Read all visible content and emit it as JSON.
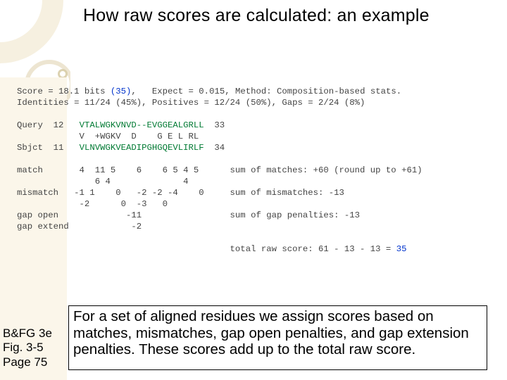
{
  "title": "How raw scores are calculated: an example",
  "blast": {
    "score_line": "Score = 18.1 bits ",
    "score_paren_open": "(",
    "score_value": "35",
    "score_paren_close": ")",
    "score_rest": ",   Expect = 0.015, Method: Composition-based stats.",
    "identities_line": "Identities = 11/24 (45%), Positives = 12/24 (50%), Gaps = 2/24 (8%)",
    "query_label": "Query  12   ",
    "query_seq": "VTALWGKVNVD--EVGGEALGRLL",
    "query_end": "  33",
    "midline": "            V  +WGKV  D    G E L RL ",
    "sbjct_label": "Sbjct  11   ",
    "sbjct_seq": "VLNVWGKVEADIPGHGQEVLIRLF",
    "sbjct_end": "  34",
    "match_label": "match       4  11 5    6    6 5 4 5      sum of matches: +60 (round up to +61)",
    "match_line2": "               6 4              4",
    "mismatch_label": "mismatch   -1 1    0   -2 -2 -4    0     sum of mismatches: -13",
    "mismatch_l2": "            -2      0  -3   0",
    "gapopen": "gap open             -11                 sum of gap penalties: -13",
    "gapextend": "gap extend            -2",
    "totallabel": "                                         total raw score: 61 - 13 - 13 = ",
    "total_value": "35"
  },
  "caption": "For a set of aligned residues we assign scores based on matches, mismatches, gap open penalties, and gap extension penalties. These scores add up to the total raw score.",
  "citation": {
    "l1": "B&FG 3e",
    "l2": "Fig. 3-5",
    "l3": "Page 75"
  }
}
